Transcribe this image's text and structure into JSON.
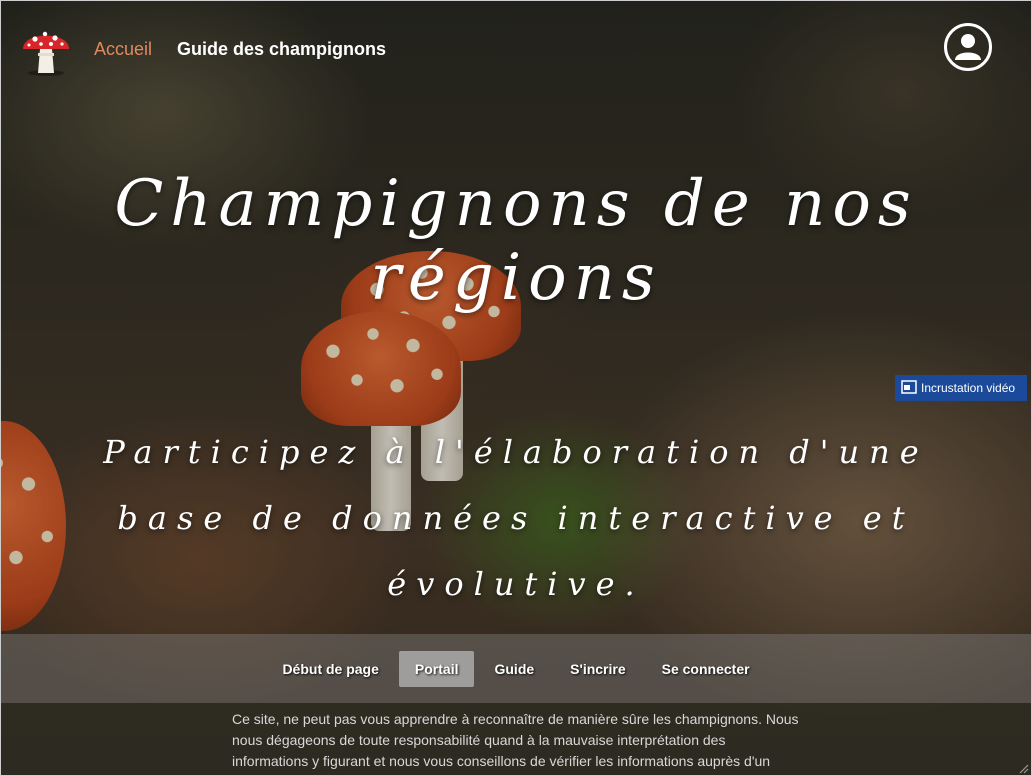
{
  "header": {
    "logo_icon": "fly-agaric-mushroom-icon",
    "nav_home": "Accueil",
    "nav_guide": "Guide des champignons",
    "account_icon": "user-account-icon",
    "home_color": "#e0895f"
  },
  "hero": {
    "title": "Champignons de nos régions",
    "subtitle": "Participez à l'élaboration d'une base de données interactive et évolutive."
  },
  "pip": {
    "label": "Incrustation vidéo",
    "icon": "picture-in-picture-icon",
    "color": "#1b4a9a"
  },
  "bottom_nav": {
    "items": [
      {
        "label": "Début de page"
      },
      {
        "label": "Portail",
        "active": true
      },
      {
        "label": "Guide"
      },
      {
        "label": "S'incrire"
      },
      {
        "label": "Se connecter"
      }
    ]
  },
  "disclaimer": {
    "text": "Ce site, ne peut pas vous apprendre à reconnaître de manière sûre les champignons. Nous nous dégageons de toute responsabilité quand à la mauvaise interprétation des informations y figurant et nous vous conseillons de vérifier les informations auprès d'un"
  }
}
